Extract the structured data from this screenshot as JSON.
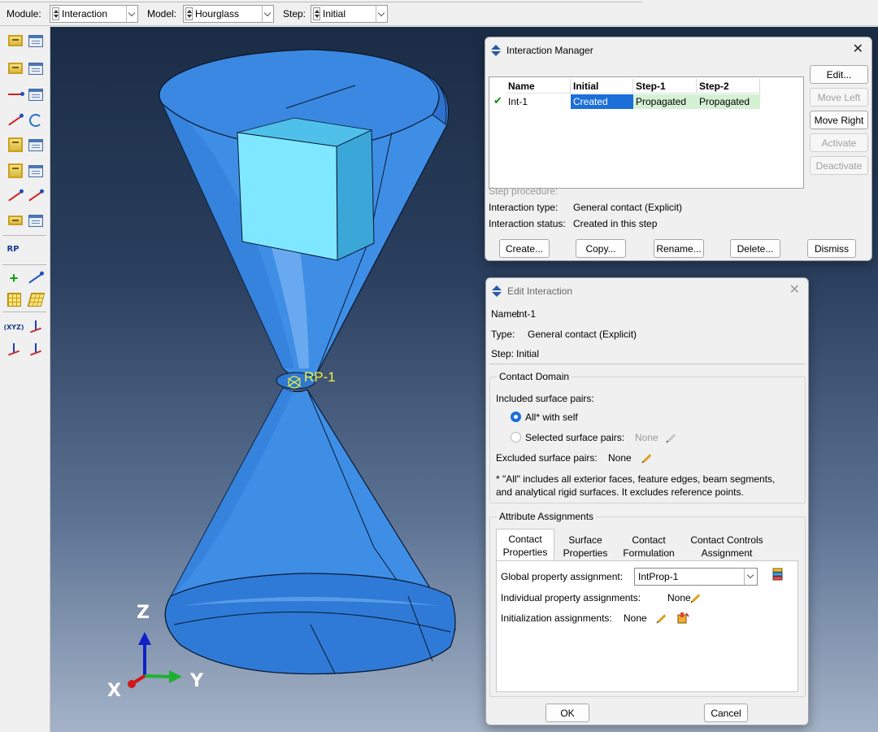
{
  "context": {
    "module_label": "Module:",
    "module_value": "Interaction",
    "model_label": "Model:",
    "model_value": "Hourglass",
    "step_label": "Step:",
    "step_value": "Initial"
  },
  "toolbox": {
    "icons": [
      "create-interaction-icon",
      "interaction-manager-icon",
      "create-interaction-property-icon",
      "interaction-property-manager-icon",
      "create-contact-control-icon",
      "contact-control-manager-icon",
      "create-contact-initialization-icon",
      "contact-stabilization-icon",
      "create-constraint-icon",
      "constraint-manager-icon",
      "create-connector-section-icon",
      "connector-section-manager-icon",
      "create-wire-icon",
      "create-connector-assignment-icon",
      "create-amplitude-icon",
      "amplitude-manager-icon",
      "reference-point-icon",
      "create-datum-point-icon",
      "create-datum-axis-icon",
      "create-datum-plane-icon",
      "partition-icon",
      "create-datum-csys-icon",
      "datum-csys-axis-icon",
      "edge-partition-icon",
      "triad-axis-icon"
    ],
    "rp_text": "RP"
  },
  "viewport": {
    "rp_label": "RP-1",
    "triad": {
      "z": "Z",
      "x": "X",
      "y": "Y"
    },
    "colors": {
      "cone": "#3f8ee6",
      "cone_dark": "#2a6fc8",
      "block_front": "#7fe7ff",
      "block_side": "#3aa7d8",
      "triad_z": "#1020c8",
      "triad_x": "#d01818",
      "triad_y": "#20b030"
    }
  },
  "interaction_manager": {
    "title": "Interaction Manager",
    "columns": [
      "Name",
      "Initial",
      "Step-1",
      "Step-2"
    ],
    "rows": [
      {
        "name": "Int-1",
        "initial": "Created",
        "step1": "Propagated",
        "step2": "Propagated"
      }
    ],
    "buttons": {
      "edit": "Edit...",
      "move_left": "Move Left",
      "move_right": "Move Right",
      "activate": "Activate",
      "deactivate": "Deactivate"
    },
    "step_procedure_label": "Step procedure:",
    "interaction_type_label": "Interaction type:",
    "interaction_type_value": "General contact (Explicit)",
    "interaction_status_label": "Interaction status:",
    "interaction_status_value": "Created in this step",
    "bottom_buttons": {
      "create": "Create...",
      "copy": "Copy...",
      "rename": "Rename...",
      "delete": "Delete...",
      "dismiss": "Dismiss"
    }
  },
  "edit_interaction": {
    "title": "Edit Interaction",
    "name_label": "Name:",
    "name_value": "Int-1",
    "type_label": "Type:",
    "type_value": "General contact (Explicit)",
    "step_label": "Step:",
    "step_value": "Initial",
    "contact_domain": {
      "legend": "Contact Domain",
      "included_label": "Included surface pairs:",
      "all_option": "All* with self",
      "selected_option": "Selected surface pairs:",
      "selected_value": "None",
      "excluded_label": "Excluded surface pairs:",
      "excluded_value": "None",
      "note_line1": "* \"All\" includes all exterior faces, feature edges, beam segments,",
      "note_line2": "and analytical rigid surfaces. It excludes reference points."
    },
    "attribute_assignments": {
      "legend": "Attribute Assignments",
      "tabs": [
        {
          "line1": "Contact",
          "line2": "Properties"
        },
        {
          "line1": "Surface",
          "line2": "Properties"
        },
        {
          "line1": "Contact",
          "line2": "Formulation"
        },
        {
          "line1": "Contact Controls",
          "line2": "Assignment"
        }
      ],
      "global_label": "Global property assignment:",
      "global_value": "IntProp-1",
      "individual_label": "Individual property assignments:",
      "individual_value": "None",
      "initialization_label": "Initialization assignments:",
      "initialization_value": "None"
    },
    "ok": "OK",
    "cancel": "Cancel"
  }
}
